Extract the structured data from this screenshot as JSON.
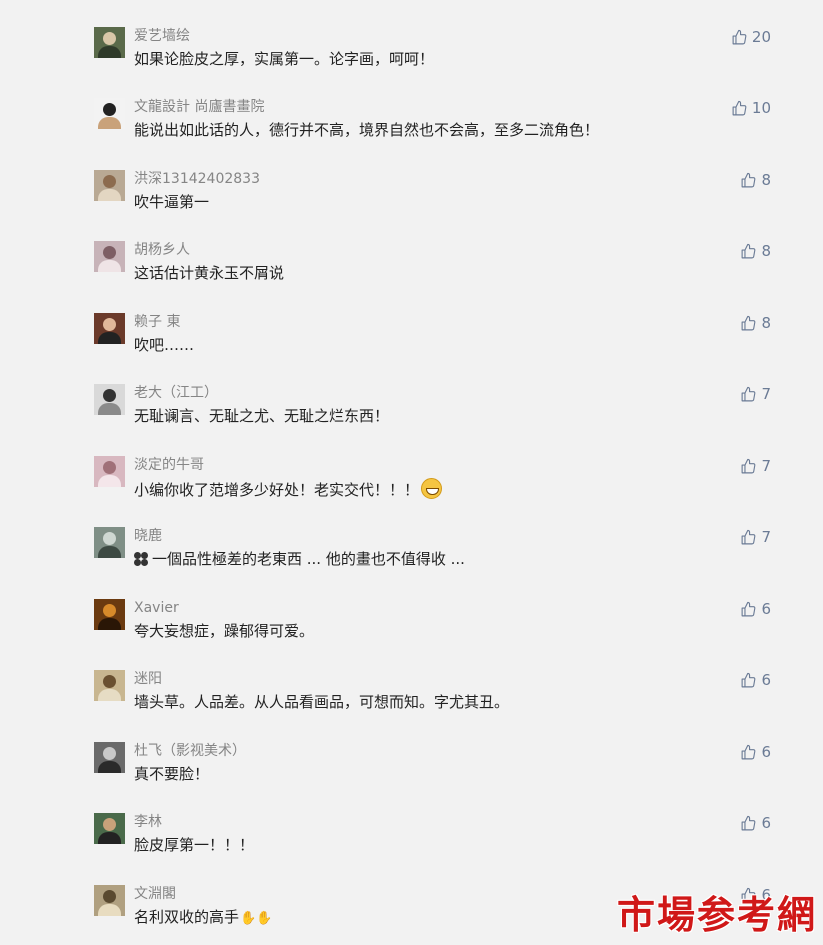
{
  "comments": [
    {
      "nickname": "爱艺墙绘",
      "text": "如果论脸皮之厚，实属第一。论字画，呵呵！",
      "likes": "20",
      "avatar_colors": [
        "#5a6a4a",
        "#d9c7a8",
        "#2f3a2a"
      ]
    },
    {
      "nickname": "文龍設計󠄀 尚廬書畫院",
      "text": "能说出如此话的人，德行并不高，境界自然也不会高，至多二流角色！",
      "likes": "10",
      "avatar_colors": [
        "#f3f3f3",
        "#222222",
        "#c9a27a"
      ]
    },
    {
      "nickname": "洪深13142402833",
      "text": "吹牛逼第一",
      "likes": "8",
      "avatar_colors": [
        "#b9a994",
        "#8c6b4e",
        "#e3d6c2"
      ]
    },
    {
      "nickname": "胡杨乡人",
      "text": "这话估计黄永玉不屑说",
      "likes": "8",
      "avatar_colors": [
        "#c7b3b8",
        "#7d5e64",
        "#efe4e6"
      ]
    },
    {
      "nickname": "赖子 東",
      "text": "吹吧……",
      "likes": "8",
      "avatar_colors": [
        "#6b3a2a",
        "#e0b89a",
        "#222222"
      ]
    },
    {
      "nickname": "老大（江工）",
      "text": "无耻谰言、无耻之尤、无耻之烂东西！",
      "likes": "7",
      "avatar_colors": [
        "#d9d9d9",
        "#333333",
        "#8a8a8a"
      ]
    },
    {
      "nickname": "淡定的牛哥",
      "text": "小编你收了范增多少好处！老实交代！！！",
      "likes": "7",
      "avatar_colors": [
        "#d8b8c0",
        "#a07078",
        "#f4e6ea"
      ]
    },
    {
      "nickname": "晓鹿",
      "text": "一個品性極差的老東西 ... 他的畫也不值得收 ...",
      "likes": "7",
      "avatar_colors": [
        "#7f8f86",
        "#cfd8d2",
        "#3d4a43"
      ]
    },
    {
      "nickname": "Xavier",
      "text": "夸大妄想症，躁郁得可爱。",
      "likes": "6",
      "avatar_colors": [
        "#6b3a10",
        "#d88a2a",
        "#2a1606"
      ]
    },
    {
      "nickname": "迷阳",
      "text": "墙头草。人品差。从人品看画品，可想而知。字尤其丑。",
      "likes": "6",
      "avatar_colors": [
        "#c8b690",
        "#6a5030",
        "#e6dcc4"
      ]
    },
    {
      "nickname": "杜飞（影视美术）",
      "text": "真不要脸！",
      "likes": "6",
      "avatar_colors": [
        "#6a6a6a",
        "#c9c9c9",
        "#2a2a2a"
      ]
    },
    {
      "nickname": "李林",
      "text": "脸皮厚第一！！！",
      "likes": "6",
      "avatar_colors": [
        "#4a6a4a",
        "#c9a27a",
        "#222222"
      ]
    },
    {
      "nickname": "文淵閣",
      "text": "名利双收的高手",
      "likes": "6",
      "avatar_colors": [
        "#b0a080",
        "#5a4a30",
        "#e8dcc0"
      ]
    }
  ],
  "watermark_text": "市場参考網",
  "colors": {
    "background": "#f2f2f2",
    "nickname": "#858585",
    "text": "#222222",
    "like_icon": "#6b7b95",
    "watermark": "#d01818"
  },
  "icons": {
    "like": "thumbs-up-icon",
    "grin": "grinning-emoji-icon",
    "flower": "flower-emoji-icon",
    "hands": "clapping-hands-emoji-icon"
  }
}
